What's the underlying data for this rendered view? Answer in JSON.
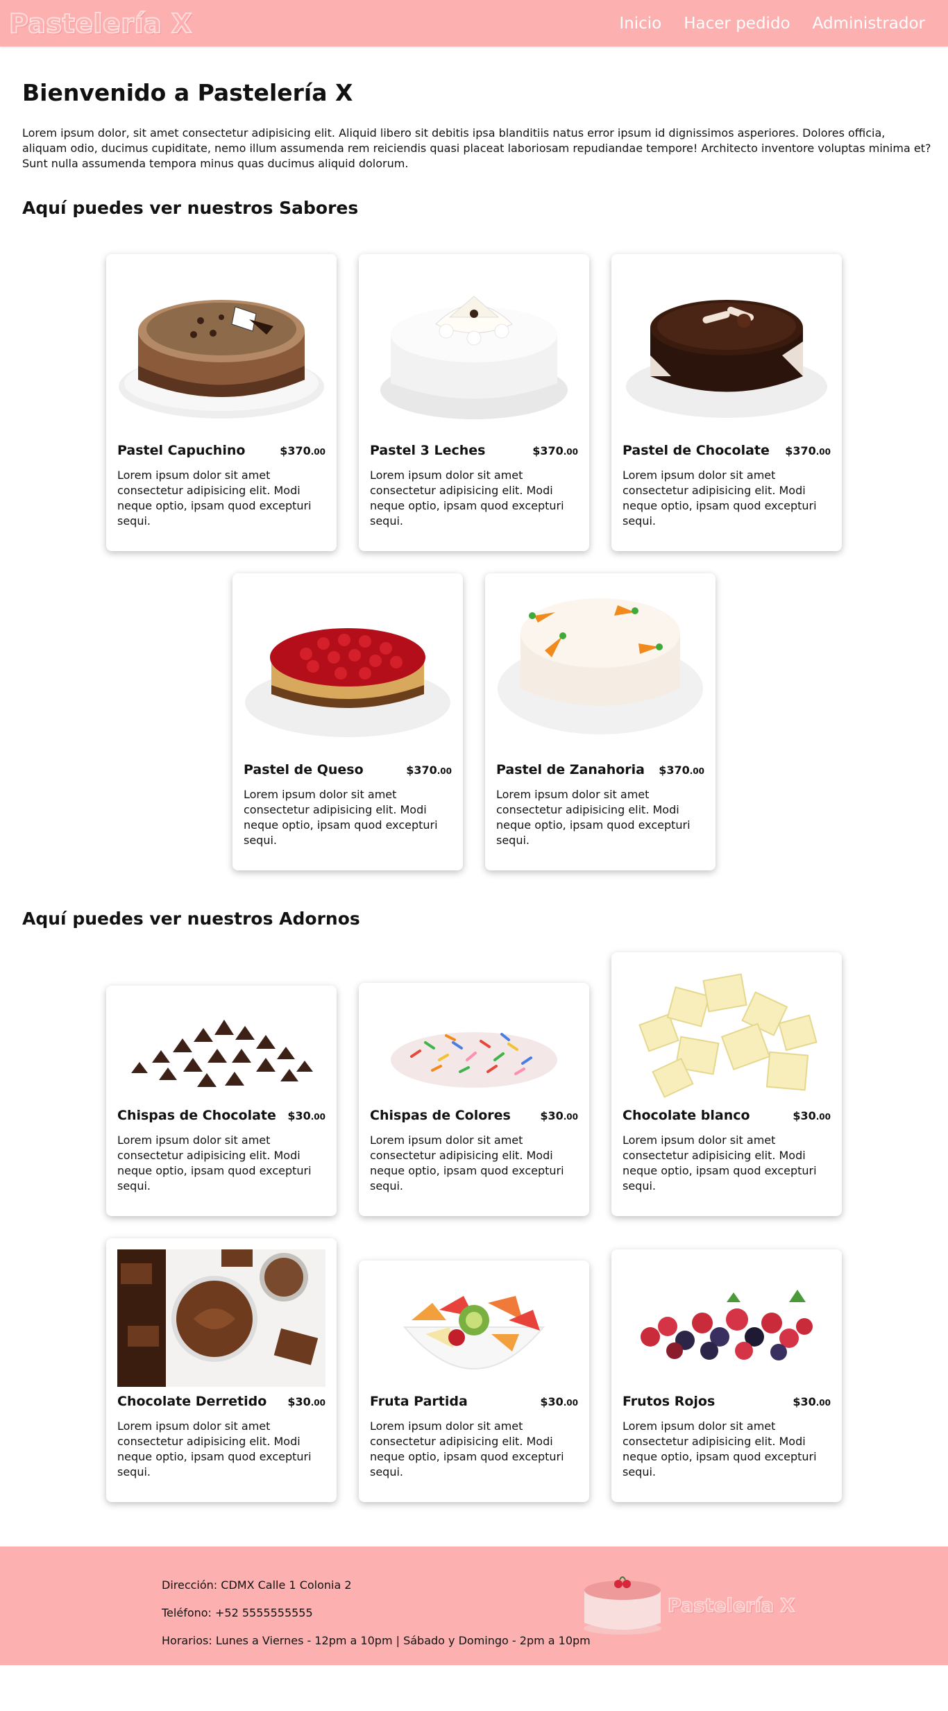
{
  "navbar": {
    "brand": "Pastelería X",
    "links": [
      "Inicio",
      "Hacer pedido",
      "Administrador"
    ]
  },
  "main": {
    "welcome_title": "Bienvenido a Pastelería X",
    "intro": "Lorem ipsum dolor, sit amet consectetur adipisicing elit. Aliquid libero sit debitis ipsa blanditiis natus error ipsum id dignissimos asperiores. Dolores officia, aliquam odio, ducimus cupiditate, nemo illum assumenda rem reiciendis quasi placeat laboriosam repudiandae tempore! Architecto inventore voluptas minima et? Sunt nulla assumenda tempora minus quas ducimus aliquid dolorum.",
    "sabores_title": "Aquí puedes ver nuestros Sabores",
    "adornos_title": "Aquí puedes ver nuestros Adornos"
  },
  "sabores": [
    {
      "name": "Pastel Capuchino",
      "price": "$370",
      "cents": ".00",
      "desc": "Lorem ipsum dolor sit amet consectetur adipisicing elit. Modi neque optio, ipsam quod excepturi sequi.",
      "icon": "coffee-cake-image"
    },
    {
      "name": "Pastel 3 Leches",
      "price": "$370",
      "cents": ".00",
      "desc": "Lorem ipsum dolor sit amet consectetur adipisicing elit. Modi neque optio, ipsam quod excepturi sequi.",
      "icon": "tres-leches-cake-image"
    },
    {
      "name": "Pastel de Chocolate",
      "price": "$370",
      "cents": ".00",
      "desc": "Lorem ipsum dolor sit amet consectetur adipisicing elit. Modi neque optio, ipsam quod excepturi sequi.",
      "icon": "chocolate-cake-image"
    },
    {
      "name": "Pastel de Queso",
      "price": "$370",
      "cents": ".00",
      "desc": "Lorem ipsum dolor sit amet consectetur adipisicing elit. Modi neque optio, ipsam quod excepturi sequi.",
      "icon": "cheesecake-image"
    },
    {
      "name": "Pastel de Zanahoria",
      "price": "$370",
      "cents": ".00",
      "desc": "Lorem ipsum dolor sit amet consectetur adipisicing elit. Modi neque optio, ipsam quod excepturi sequi.",
      "icon": "carrot-cake-image"
    }
  ],
  "adornos": [
    {
      "name": "Chispas de Chocolate",
      "price": "$30",
      "cents": ".00",
      "desc": "Lorem ipsum dolor sit amet consectetur adipisicing elit. Modi neque optio, ipsam quod excepturi sequi.",
      "icon": "chocolate-chips-image"
    },
    {
      "name": "Chispas de Colores",
      "price": "$30",
      "cents": ".00",
      "desc": "Lorem ipsum dolor sit amet consectetur adipisicing elit. Modi neque optio, ipsam quod excepturi sequi.",
      "icon": "sprinkles-image"
    },
    {
      "name": "Chocolate blanco",
      "price": "$30",
      "cents": ".00",
      "desc": "Lorem ipsum dolor sit amet consectetur adipisicing elit. Modi neque optio, ipsam quod excepturi sequi.",
      "icon": "white-chocolate-image"
    },
    {
      "name": "Chocolate Derretido",
      "price": "$30",
      "cents": ".00",
      "desc": "Lorem ipsum dolor sit amet consectetur adipisicing elit. Modi neque optio, ipsam quod excepturi sequi.",
      "icon": "melted-chocolate-image"
    },
    {
      "name": "Fruta Partida",
      "price": "$30",
      "cents": ".00",
      "desc": "Lorem ipsum dolor sit amet consectetur adipisicing elit. Modi neque optio, ipsam quod excepturi sequi.",
      "icon": "fruit-bowl-image"
    },
    {
      "name": "Frutos Rojos",
      "price": "$30",
      "cents": ".00",
      "desc": "Lorem ipsum dolor sit amet consectetur adipisicing elit. Modi neque optio, ipsam quod excepturi sequi.",
      "icon": "berries-image"
    }
  ],
  "footer": {
    "address": "Dirección: CDMX Calle 1 Colonia 2",
    "phone": "Teléfono: +52 5555555555",
    "hours": "Horarios: Lunes a Viernes - 12pm a 10pm | Sábado y Domingo - 2pm a 10pm",
    "logo_text": "Pastelería X",
    "logo_icon": "cake-logo-icon"
  },
  "colors": {
    "brand_pink": "#fdb0b0",
    "text": "#111111"
  }
}
